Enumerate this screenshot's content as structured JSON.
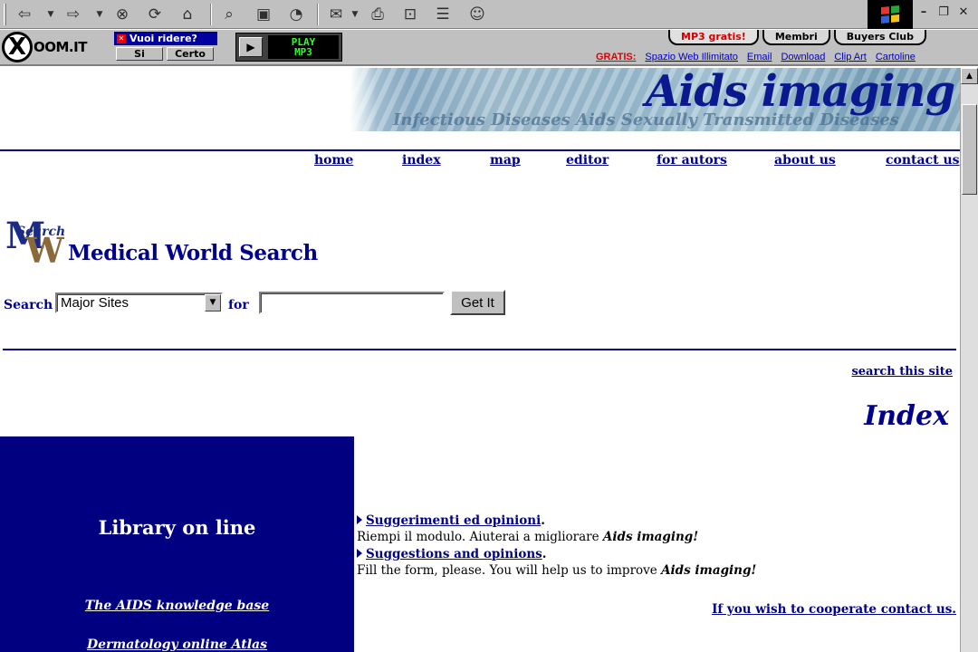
{
  "xoom_bar": {
    "logo_text": "OOM.IT",
    "logo_mark": "X",
    "promo_title": "Vuoi ridere?",
    "promo_yes": "Si",
    "promo_sure": "Certo",
    "player_label_line1": "PLAY",
    "player_label_line2": "MP3",
    "tabs": [
      "MP3 gratis!",
      "Membri",
      "Buyers Club"
    ],
    "gratis_label": "GRATIS:",
    "gratis_links": [
      "Spazio Web Illimitato",
      "Email",
      "Download",
      "Clip Art",
      "Cartoline"
    ]
  },
  "banner": {
    "title": "Aids imaging",
    "subtitle": "Infectious Diseases  Aids  Sexually Transmitted Diseases"
  },
  "nav": [
    {
      "label": "home"
    },
    {
      "label": "index"
    },
    {
      "label": "map"
    },
    {
      "label": "editor"
    },
    {
      "label": "for autors"
    },
    {
      "label": "about us"
    },
    {
      "label": "contact us"
    }
  ],
  "mws": {
    "logo_letters": "MW",
    "logo_script": "Search",
    "title": "Medical World Search",
    "search_label": "Search",
    "select_value": "Major Sites",
    "for_label": "for",
    "input_value": "",
    "button_label": "Get It"
  },
  "search_site": "search this site",
  "index_title": "Index",
  "library": {
    "title": "Library on line",
    "links": [
      "The AIDS knowledge base",
      "Dermatology online Atlas"
    ]
  },
  "content": {
    "it_link": "Suggerimenti ed opinioni",
    "it_text": "Riempi il modulo. Aiuterai a migliorare",
    "it_em": "Aids imaging!",
    "en_link": "Suggestions and opinions",
    "en_text": "Fill the form, please. You will help us to improve",
    "en_em": "Aids imaging!",
    "period": ".",
    "cooperate": "If you wish to cooperate contact us."
  }
}
